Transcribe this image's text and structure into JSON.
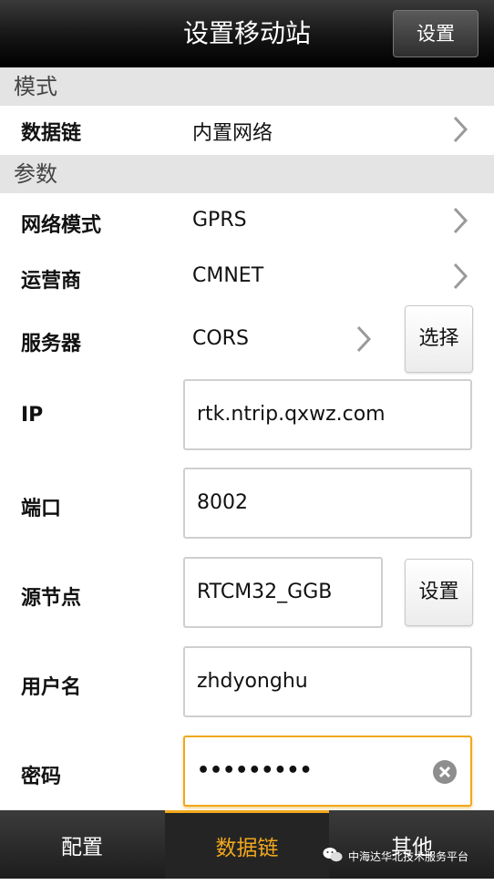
{
  "header": {
    "title": "设置移动站",
    "settings_button": "设置"
  },
  "sections": {
    "mode": "模式",
    "params": "参数"
  },
  "rows": {
    "datalink": {
      "label": "数据链",
      "value": "内置网络"
    },
    "network_mode": {
      "label": "网络模式",
      "value": "GPRS"
    },
    "operator": {
      "label": "运营商",
      "value": "CMNET"
    },
    "server": {
      "label": "服务器",
      "value": "CORS",
      "button": "选择"
    },
    "ip": {
      "label": "IP",
      "value": "rtk.ntrip.qxwz.com"
    },
    "port": {
      "label": "端口",
      "value": "8002"
    },
    "mountpoint": {
      "label": "源节点",
      "value": "RTCM32_GGB",
      "button": "设置"
    },
    "username": {
      "label": "用户名",
      "value": "zhdyonghu"
    },
    "password": {
      "label": "密码",
      "value": "•••••••••"
    }
  },
  "tabs": [
    {
      "label": "配置",
      "active": false
    },
    {
      "label": "数据链",
      "active": true
    },
    {
      "label": "其他",
      "active": false
    }
  ],
  "watermark": {
    "text": "中海达华北技术服务平台"
  },
  "colors": {
    "accent": "#f2a81d",
    "section_bg": "#e4e4e4",
    "header_bg": "#141414"
  }
}
